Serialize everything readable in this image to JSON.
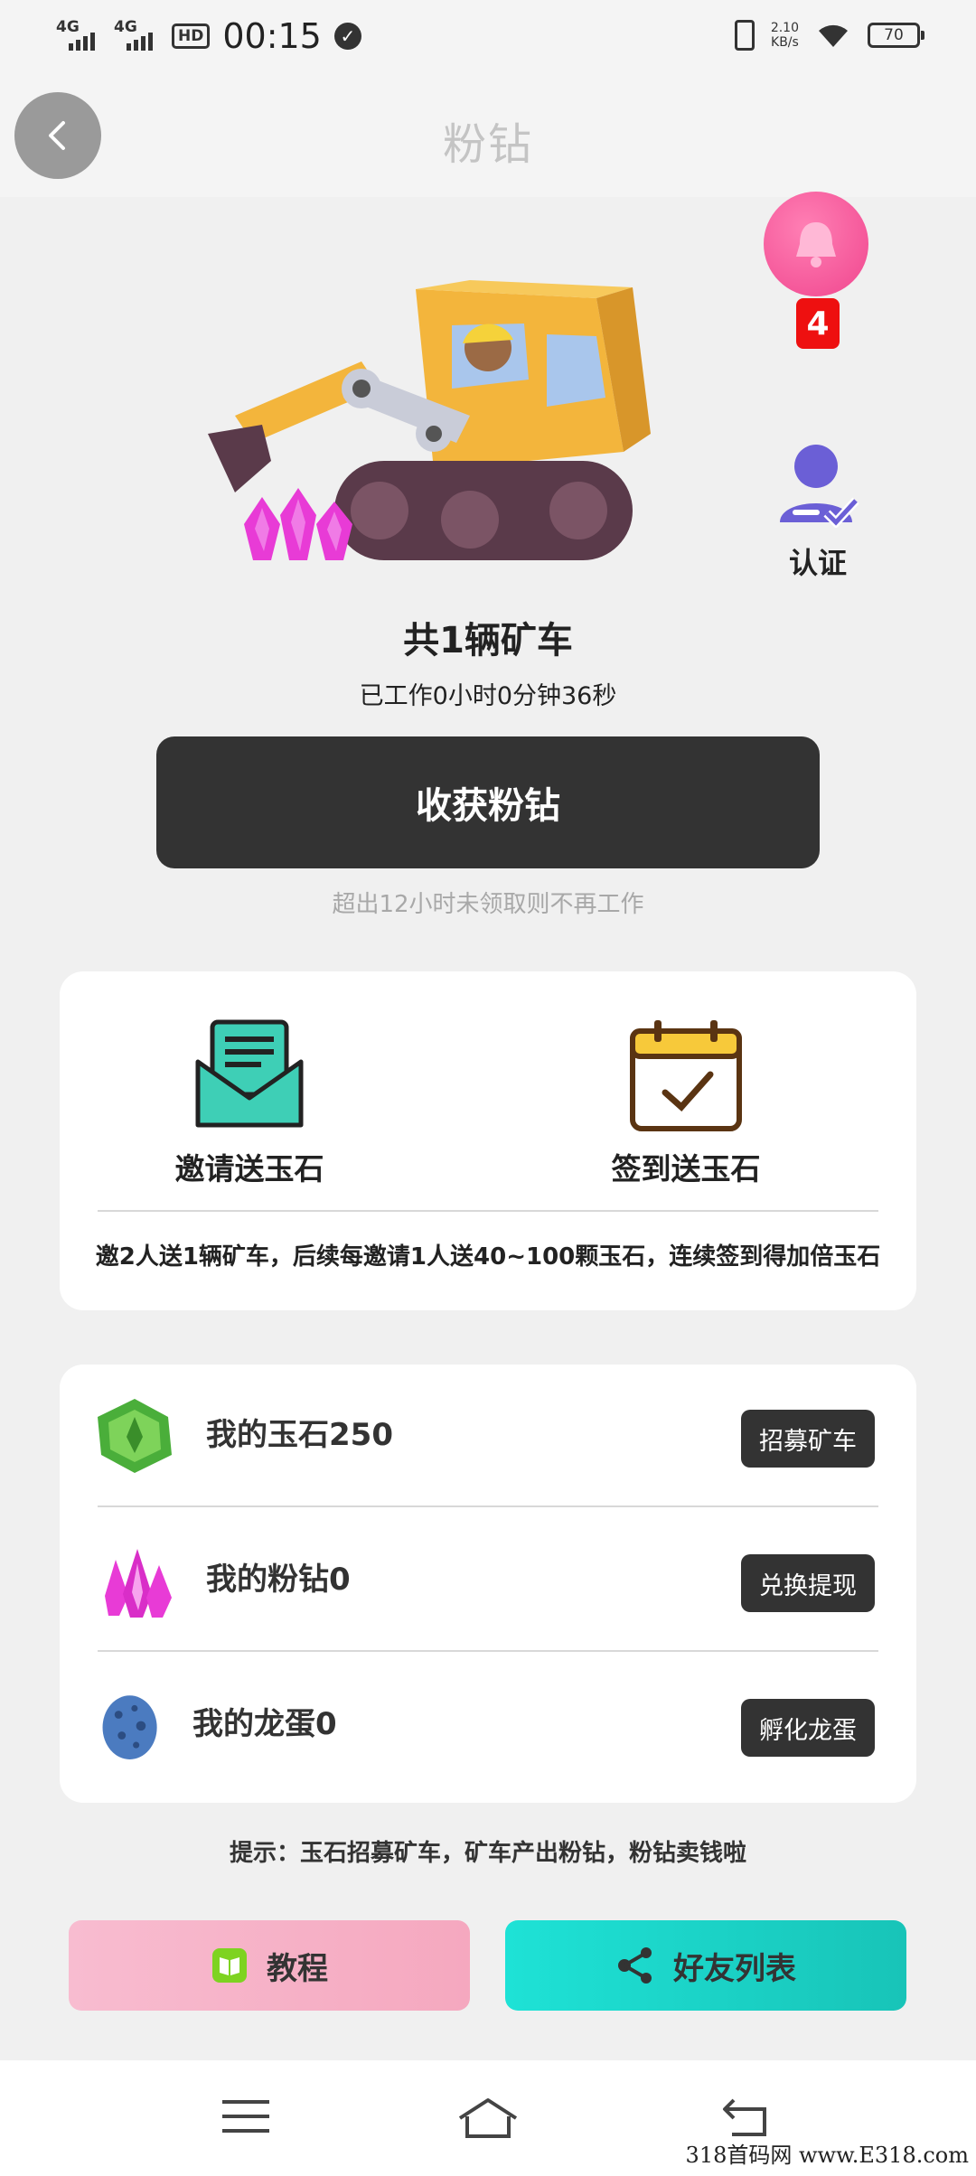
{
  "status_bar": {
    "signal1": "4G",
    "signal2": "4G",
    "hd": "HD",
    "time": "00:15",
    "speed_value": "2.10",
    "speed_unit": "KB/s",
    "battery": "70"
  },
  "header": {
    "title": "粉钻",
    "back_icon": "chevron-left-icon"
  },
  "notifications": {
    "count": "4"
  },
  "certify": {
    "label": "认证"
  },
  "mining": {
    "car_count": "共1辆矿车",
    "work_time": "已工作0小时0分钟36秒",
    "harvest_label": "收获粉钻",
    "harvest_note": "超出12小时未领取则不再工作"
  },
  "rewards": {
    "invite_label": "邀请送玉石",
    "checkin_label": "签到送玉石",
    "description": "邀2人送1辆矿车，后续每邀请1人送40~100颗玉石，连续签到得加倍玉石"
  },
  "assets": [
    {
      "label": "我的玉石250",
      "button": "招募矿车",
      "icon": "jade-icon"
    },
    {
      "label": "我的粉钻0",
      "button": "兑换提现",
      "icon": "pink-diamond-icon"
    },
    {
      "label": "我的龙蛋0",
      "button": "孵化龙蛋",
      "icon": "dragon-egg-icon"
    }
  ],
  "tip": "提示：玉石招募矿车，矿车产出粉钻，粉钻卖钱啦",
  "bottom": {
    "tutorial": "教程",
    "friends": "好友列表"
  },
  "watermark": "318首码网 www.E318.com",
  "colors": {
    "accent_pink": "#f0468e",
    "dark_button": "#333333",
    "teal": "#1ee2d6",
    "badge_red": "#ee1010"
  }
}
